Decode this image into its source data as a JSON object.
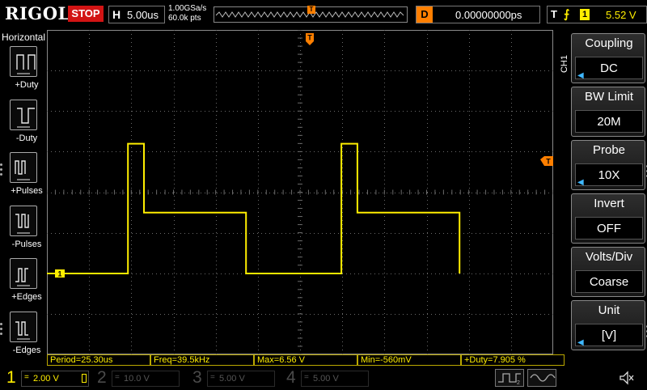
{
  "brand": "RIGOL",
  "run_state": "STOP",
  "timebase": {
    "letter": "H",
    "value": "5.00us",
    "sample_rate": "1.00GSa/s",
    "memory_depth": "60.0k pts",
    "trigger_marker": "T"
  },
  "delay": {
    "letter": "D",
    "value": "0.00000000ps"
  },
  "trigger": {
    "letter": "T",
    "edge_icon": "rising-edge-icon",
    "source": "1",
    "level": "5.52 V"
  },
  "left_menu": {
    "title": "Horizontal",
    "items": [
      {
        "label": "+Duty",
        "icon": "positive-duty-icon"
      },
      {
        "label": "-Duty",
        "icon": "negative-duty-icon"
      },
      {
        "label": "+Pulses",
        "icon": "positive-pulses-icon"
      },
      {
        "label": "-Pulses",
        "icon": "negative-pulses-icon"
      },
      {
        "label": "+Edges",
        "icon": "positive-edges-icon"
      },
      {
        "label": "-Edges",
        "icon": "negative-edges-icon"
      }
    ]
  },
  "grid_markers": {
    "channel_marker": "1",
    "trigger_position_marker": "T",
    "trigger_level_marker": "T"
  },
  "right_menu": {
    "channel": "CH1",
    "items": [
      {
        "title": "Coupling",
        "value": "DC"
      },
      {
        "title": "BW Limit",
        "value": "20M"
      },
      {
        "title": "Probe",
        "value": "10X"
      },
      {
        "title": "Invert",
        "value": "OFF"
      },
      {
        "title": "Volts/Div",
        "value": "Coarse"
      },
      {
        "title": "Unit",
        "value": "[V]"
      }
    ]
  },
  "measurements": [
    "Period=25.30us",
    "Freq=39.5kHz",
    "Max=6.56 V",
    "Min=-560mV",
    "+Duty=7.905 %"
  ],
  "channels": [
    {
      "number": "1",
      "scale": "2.00 V",
      "color": "#ffee00",
      "active": true
    },
    {
      "number": "2",
      "scale": "10.0 V",
      "color": "#00c8c8",
      "active": false
    },
    {
      "number": "3",
      "scale": "5.00 V",
      "color": "#e040e0",
      "active": false
    },
    {
      "number": "4",
      "scale": "5.00 V",
      "color": "#3a7bff",
      "active": false
    }
  ],
  "colors": {
    "trace": "#ffee00",
    "accent": "#ff7f00",
    "stop": "#d21414",
    "grid": "#6a6a6a"
  },
  "waveform": {
    "volts_per_div": 2.0,
    "time_per_div_us": 5.0,
    "period_us": 25.3,
    "levels_v": {
      "low": 0.0,
      "mid": 3.0,
      "high": 6.4
    },
    "high_width_us": 1.9,
    "mid_width_us": 12.1,
    "first_rise_us": 9.6
  }
}
